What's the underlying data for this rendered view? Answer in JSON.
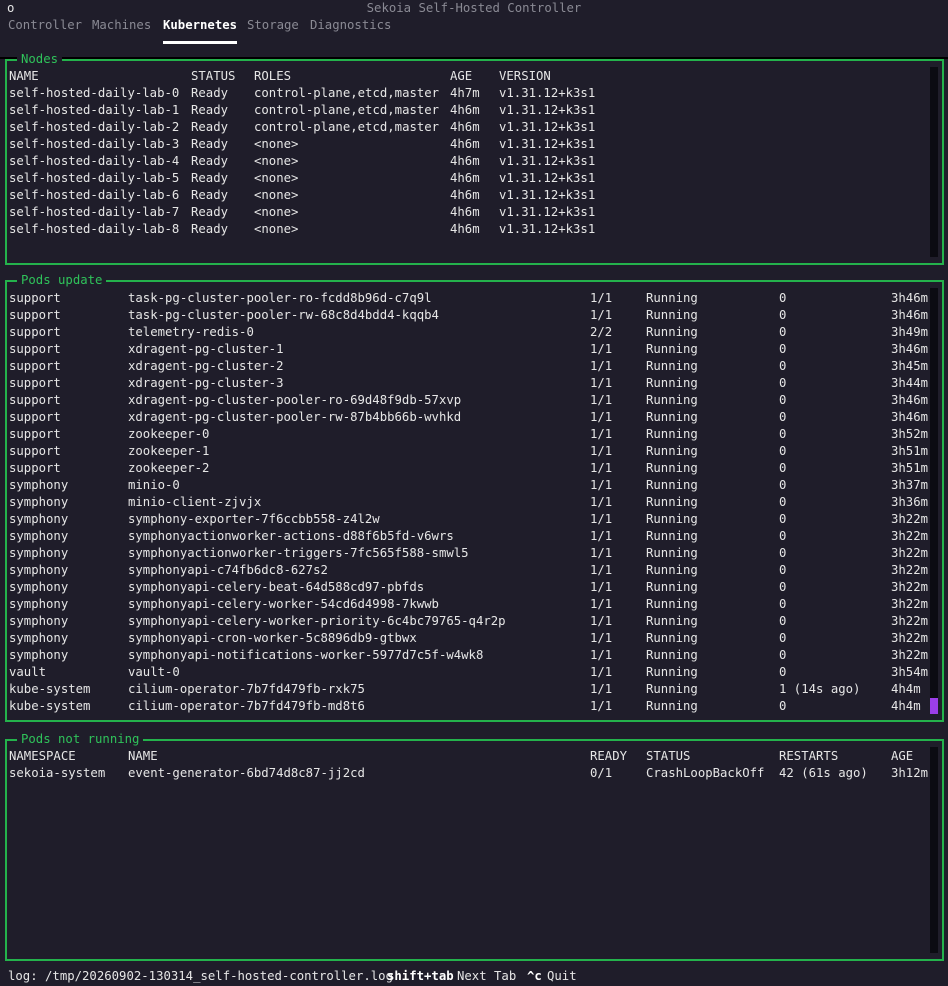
{
  "window": {
    "title": "Sekoia Self-Hosted Controller",
    "icon": "circle-icon"
  },
  "tabs": [
    {
      "label": "Controller",
      "active": false
    },
    {
      "label": "Machines",
      "active": false
    },
    {
      "label": "Kubernetes",
      "active": true
    },
    {
      "label": "Storage",
      "active": false
    },
    {
      "label": "Diagnostics",
      "active": false
    }
  ],
  "nodes": {
    "title": "Nodes",
    "headers": [
      "NAME",
      "STATUS",
      "ROLES",
      "AGE",
      "VERSION"
    ],
    "rows": [
      [
        "self-hosted-daily-lab-0",
        "Ready",
        "control-plane,etcd,master",
        "4h7m",
        "v1.31.12+k3s1"
      ],
      [
        "self-hosted-daily-lab-1",
        "Ready",
        "control-plane,etcd,master",
        "4h6m",
        "v1.31.12+k3s1"
      ],
      [
        "self-hosted-daily-lab-2",
        "Ready",
        "control-plane,etcd,master",
        "4h6m",
        "v1.31.12+k3s1"
      ],
      [
        "self-hosted-daily-lab-3",
        "Ready",
        "<none>",
        "4h6m",
        "v1.31.12+k3s1"
      ],
      [
        "self-hosted-daily-lab-4",
        "Ready",
        "<none>",
        "4h6m",
        "v1.31.12+k3s1"
      ],
      [
        "self-hosted-daily-lab-5",
        "Ready",
        "<none>",
        "4h6m",
        "v1.31.12+k3s1"
      ],
      [
        "self-hosted-daily-lab-6",
        "Ready",
        "<none>",
        "4h6m",
        "v1.31.12+k3s1"
      ],
      [
        "self-hosted-daily-lab-7",
        "Ready",
        "<none>",
        "4h6m",
        "v1.31.12+k3s1"
      ],
      [
        "self-hosted-daily-lab-8",
        "Ready",
        "<none>",
        "4h6m",
        "v1.31.12+k3s1"
      ]
    ]
  },
  "pods_update": {
    "title": "Pods update",
    "rows": [
      [
        "support",
        "task-pg-cluster-pooler-ro-fcdd8b96d-c7q9l",
        "1/1",
        "Running",
        "0",
        "3h46m"
      ],
      [
        "support",
        "task-pg-cluster-pooler-rw-68c8d4bdd4-kqqb4",
        "1/1",
        "Running",
        "0",
        "3h46m"
      ],
      [
        "support",
        "telemetry-redis-0",
        "2/2",
        "Running",
        "0",
        "3h49m"
      ],
      [
        "support",
        "xdragent-pg-cluster-1",
        "1/1",
        "Running",
        "0",
        "3h46m"
      ],
      [
        "support",
        "xdragent-pg-cluster-2",
        "1/1",
        "Running",
        "0",
        "3h45m"
      ],
      [
        "support",
        "xdragent-pg-cluster-3",
        "1/1",
        "Running",
        "0",
        "3h44m"
      ],
      [
        "support",
        "xdragent-pg-cluster-pooler-ro-69d48f9db-57xvp",
        "1/1",
        "Running",
        "0",
        "3h46m"
      ],
      [
        "support",
        "xdragent-pg-cluster-pooler-rw-87b4bb66b-wvhkd",
        "1/1",
        "Running",
        "0",
        "3h46m"
      ],
      [
        "support",
        "zookeeper-0",
        "1/1",
        "Running",
        "0",
        "3h52m"
      ],
      [
        "support",
        "zookeeper-1",
        "1/1",
        "Running",
        "0",
        "3h51m"
      ],
      [
        "support",
        "zookeeper-2",
        "1/1",
        "Running",
        "0",
        "3h51m"
      ],
      [
        "symphony",
        "minio-0",
        "1/1",
        "Running",
        "0",
        "3h37m"
      ],
      [
        "symphony",
        "minio-client-zjvjx",
        "1/1",
        "Running",
        "0",
        "3h36m"
      ],
      [
        "symphony",
        "symphony-exporter-7f6ccbb558-z4l2w",
        "1/1",
        "Running",
        "0",
        "3h22m"
      ],
      [
        "symphony",
        "symphonyactionworker-actions-d88f6b5fd-v6wrs",
        "1/1",
        "Running",
        "0",
        "3h22m"
      ],
      [
        "symphony",
        "symphonyactionworker-triggers-7fc565f588-smwl5",
        "1/1",
        "Running",
        "0",
        "3h22m"
      ],
      [
        "symphony",
        "symphonyapi-c74fb6dc8-627s2",
        "1/1",
        "Running",
        "0",
        "3h22m"
      ],
      [
        "symphony",
        "symphonyapi-celery-beat-64d588cd97-pbfds",
        "1/1",
        "Running",
        "0",
        "3h22m"
      ],
      [
        "symphony",
        "symphonyapi-celery-worker-54cd6d4998-7kwwb",
        "1/1",
        "Running",
        "0",
        "3h22m"
      ],
      [
        "symphony",
        "symphonyapi-celery-worker-priority-6c4bc79765-q4r2p",
        "1/1",
        "Running",
        "0",
        "3h22m"
      ],
      [
        "symphony",
        "symphonyapi-cron-worker-5c8896db9-gtbwx",
        "1/1",
        "Running",
        "0",
        "3h22m"
      ],
      [
        "symphony",
        "symphonyapi-notifications-worker-5977d7c5f-w4wk8",
        "1/1",
        "Running",
        "0",
        "3h22m"
      ],
      [
        "vault",
        "vault-0",
        "1/1",
        "Running",
        "0",
        "3h54m"
      ],
      [
        "kube-system",
        "cilium-operator-7b7fd479fb-rxk75",
        "1/1",
        "Running",
        "1 (14s ago)",
        "4h4m"
      ],
      [
        "kube-system",
        "cilium-operator-7b7fd479fb-md8t6",
        "1/1",
        "Running",
        "0",
        "4h4m"
      ]
    ]
  },
  "pods_not_running": {
    "title": "Pods not running",
    "headers": [
      "NAMESPACE",
      "NAME",
      "READY",
      "STATUS",
      "RESTARTS",
      "AGE"
    ],
    "rows": [
      [
        "sekoia-system",
        "event-generator-6bd74d8c87-jj2cd",
        "0/1",
        "CrashLoopBackOff",
        "42 (61s ago)",
        "3h12m"
      ]
    ]
  },
  "status": {
    "log": "log: /tmp/20260902-130314_self-hosted-controller.log",
    "hint1_key": "shift+tab",
    "hint1_label": "Next Tab",
    "hint2_key": "^c",
    "hint2_label": "Quit"
  },
  "colors": {
    "background": "#1f1d2a",
    "border": "#24b24c",
    "accent": "#9b3ee8"
  }
}
